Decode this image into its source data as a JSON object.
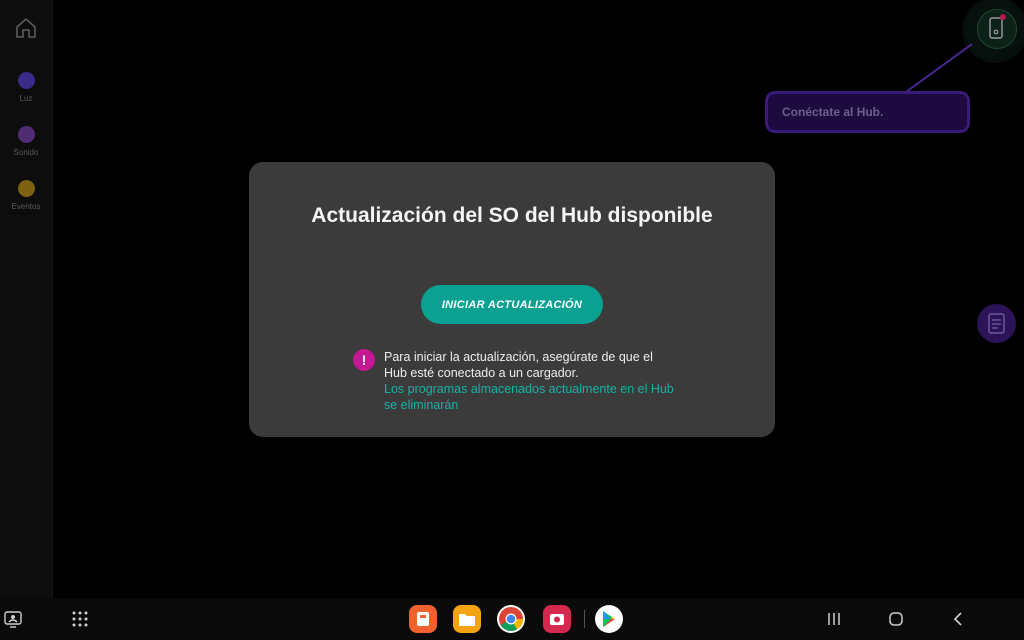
{
  "sidebar": {
    "items": [
      {
        "label": "Luz",
        "color": "#3a2b8a"
      },
      {
        "label": "Sonido",
        "color": "#4f2d74"
      },
      {
        "label": "Eventos",
        "color": "#7d6213"
      }
    ]
  },
  "hub": {
    "tooltip": "Conéctate al Hub."
  },
  "modal": {
    "title": "Actualización del SO del Hub disponible",
    "button": "INICIAR ACTUALIZACIÓN",
    "warning_symbol": "!",
    "notice": "Para iniciar la actualización, asegúrate de que el Hub esté conectado a un cargador.",
    "notice_highlight": "Los programas almacenados actualmente en el Hub se eliminarán"
  },
  "colors": {
    "accent": "#0aa193",
    "warning": "#c31a93",
    "modal_bg": "#3b3b3b",
    "link": "#15b3a4"
  },
  "taskbar": {
    "apps": [
      "sketchbook-app-icon",
      "files-app-icon",
      "chrome-app-icon",
      "screen-recorder-app-icon",
      "play-store-app-icon"
    ]
  }
}
